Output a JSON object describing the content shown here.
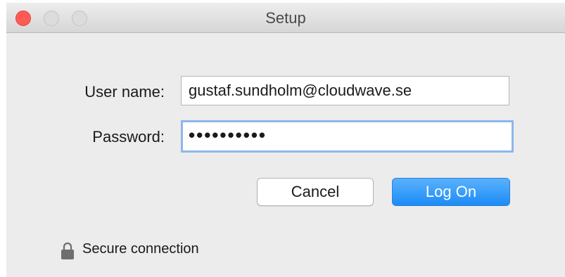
{
  "window": {
    "title": "Setup",
    "controls": [
      "close",
      "minimize",
      "zoom"
    ]
  },
  "form": {
    "username_label": "User name:",
    "username_value": "gustaf.sundholm@cloudwave.se",
    "password_label": "Password:",
    "password_value": "••••••••••"
  },
  "buttons": {
    "cancel_label": "Cancel",
    "logon_label": "Log On"
  },
  "footer": {
    "secure_text": "Secure connection",
    "icon": "lock-icon"
  },
  "colors": {
    "close": "#fd5b56",
    "primary_button": "#1c8cf6",
    "focus_ring": "#8db7ea",
    "window_bg": "#ececec"
  }
}
